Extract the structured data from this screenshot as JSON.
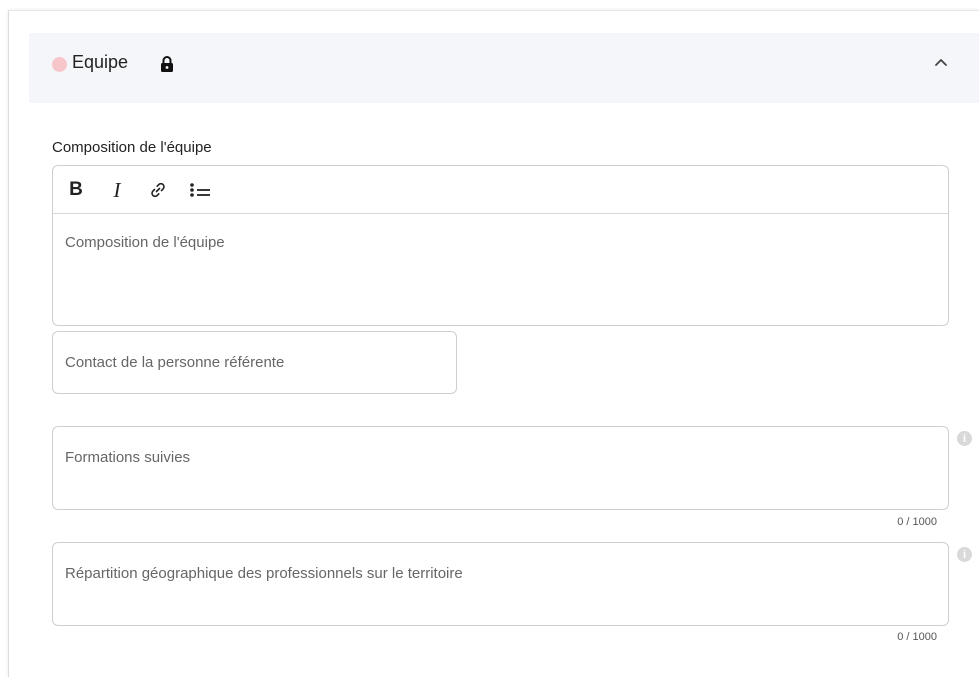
{
  "section": {
    "title": "Equipe",
    "status_color": "#f7c6cb",
    "lock_icon": "lock-icon",
    "toggle_icon": "chevron-up-icon"
  },
  "composition": {
    "label": "Composition de l'équipe",
    "placeholder": "Composition de l'équipe",
    "toolbar": {
      "bold_label": "B",
      "italic_label": "I",
      "link_icon": "link-icon",
      "list_icon": "bullet-list-icon"
    }
  },
  "contact": {
    "placeholder": "Contact de la personne référente"
  },
  "formations": {
    "placeholder": "Formations suivies",
    "counter": "0 / 1000",
    "info_icon": "info-icon"
  },
  "repartition": {
    "placeholder": "Répartition géographique des professionnels sur le territoire",
    "counter": "0 / 1000",
    "info_icon": "info-icon"
  },
  "colors": {
    "header_bg": "#f5f6fa",
    "border": "#cfcfcf"
  }
}
